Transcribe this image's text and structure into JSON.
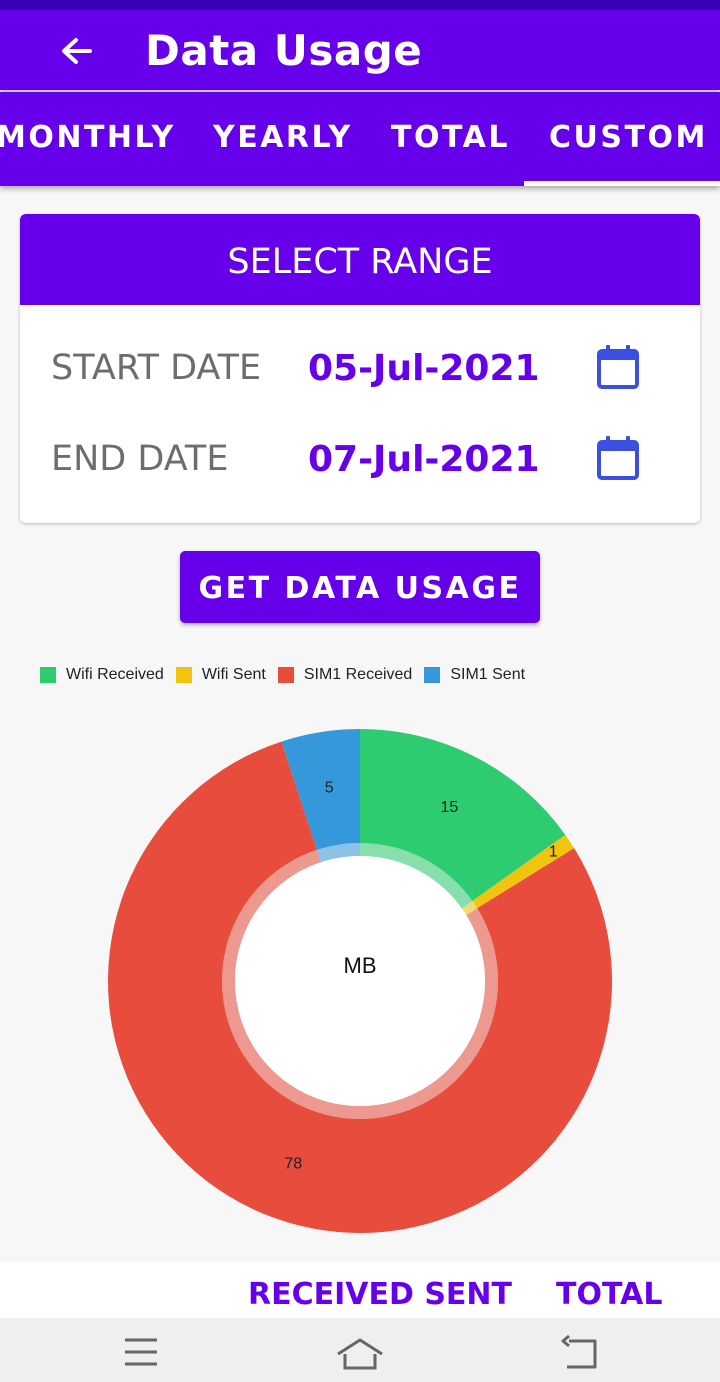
{
  "app": {
    "title": "Data Usage"
  },
  "tabs": [
    {
      "label": "MONTHLY"
    },
    {
      "label": "YEARLY"
    },
    {
      "label": "TOTAL"
    },
    {
      "label": "CUSTOM",
      "selected": true
    }
  ],
  "range_card": {
    "header": "SELECT RANGE",
    "start_label": "START DATE",
    "start_value": "05-Jul-2021",
    "end_label": "END DATE",
    "end_value": "07-Jul-2021"
  },
  "get_button": {
    "label": "GET DATA USAGE"
  },
  "colors": {
    "accent": "#6600ea",
    "wifi_received": "#2ecc71",
    "wifi_sent": "#f1c40f",
    "sim1_received": "#e74c3c",
    "sim1_sent": "#3498db"
  },
  "chart_data": {
    "type": "pie",
    "variant": "donut",
    "center_label": "MB",
    "legend_position": "top-left",
    "categories": [
      "Wifi Received",
      "Wifi Sent",
      "SIM1 Received",
      "SIM1 Sent"
    ],
    "values": [
      15,
      1,
      78,
      5
    ],
    "colors": [
      "#2ecc71",
      "#f1c40f",
      "#e74c3c",
      "#3498db"
    ]
  },
  "bottom_bar": {
    "received_sent": "RECEIVED SENT",
    "total": "TOTAL"
  },
  "nav": {
    "menu_icon": "menu-icon",
    "home_icon": "home-icon",
    "back_icon": "back-nav-icon"
  }
}
